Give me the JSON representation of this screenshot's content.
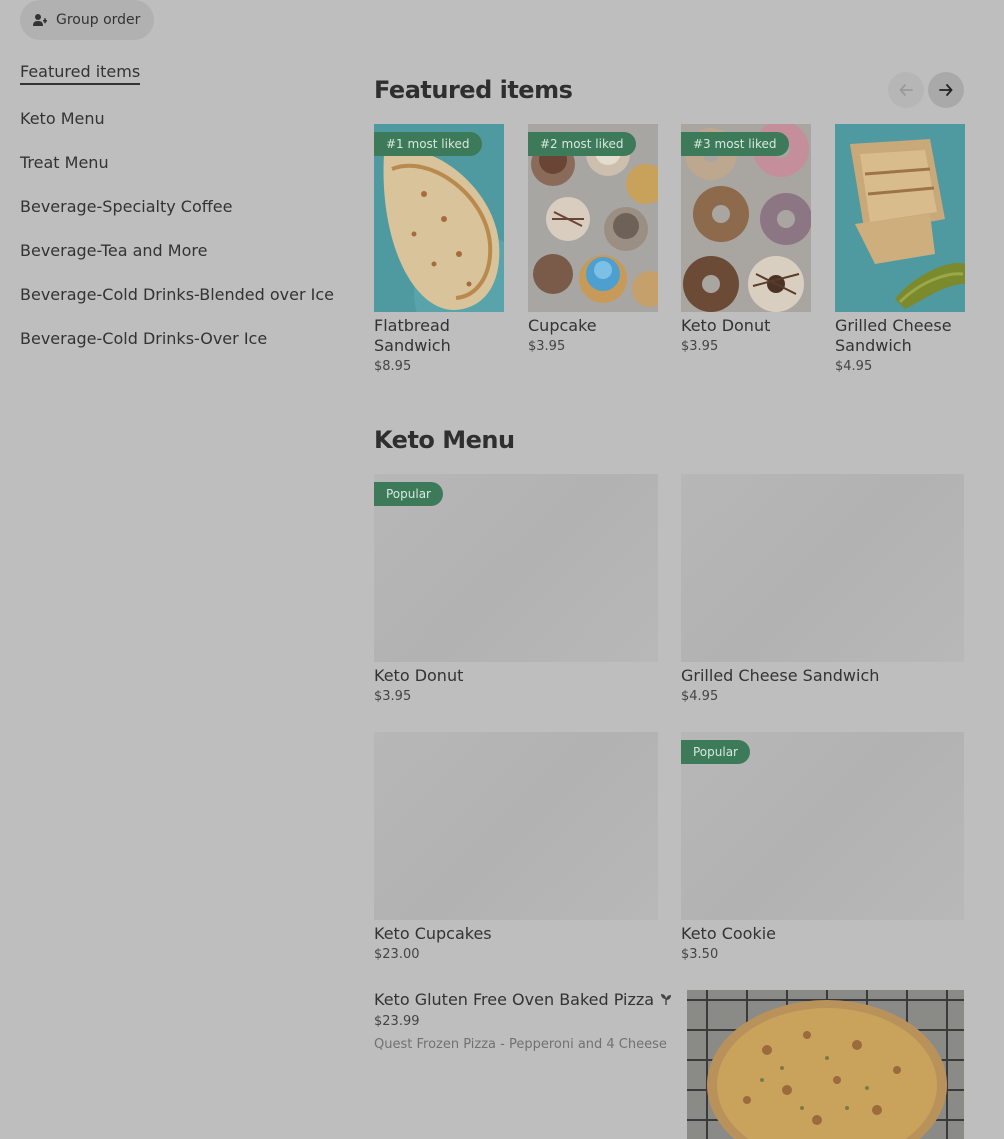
{
  "header": {
    "group_order_label": "Group order",
    "group_order_icon": "person-add-icon"
  },
  "sidebar": {
    "items": [
      {
        "label": "Featured items",
        "active": true
      },
      {
        "label": "Keto Menu"
      },
      {
        "label": "Treat Menu"
      },
      {
        "label": "Beverage-Specialty Coffee"
      },
      {
        "label": "Beverage-Tea and More"
      },
      {
        "label": "Beverage-Cold Drinks-Blended over Ice"
      },
      {
        "label": "Beverage-Cold Drinks-Over Ice"
      }
    ]
  },
  "featured": {
    "title": "Featured items",
    "prev_icon": "arrow-left-icon",
    "next_icon": "arrow-right-icon",
    "items": [
      {
        "badge": "#1 most liked",
        "name": "Flatbread Sandwich",
        "price": "$8.95"
      },
      {
        "badge": "#2 most liked",
        "name": "Cupcake",
        "price": "$3.95"
      },
      {
        "badge": "#3 most liked",
        "name": "Keto Donut",
        "price": "$3.95"
      },
      {
        "badge": "",
        "name": "Grilled Cheese Sandwich",
        "price": "$4.95"
      }
    ]
  },
  "keto_menu": {
    "title": "Keto Menu",
    "items": [
      {
        "badge": "Popular",
        "name": "Keto Donut",
        "price": "$3.95"
      },
      {
        "badge": "",
        "name": "Grilled Cheese Sandwich",
        "price": "$4.95"
      },
      {
        "badge": "",
        "name": "Keto Cupcakes",
        "price": "$23.00"
      },
      {
        "badge": "Popular",
        "name": "Keto Cookie",
        "price": "$3.50"
      }
    ],
    "pizza": {
      "name": "Keto Gluten Free Oven Baked Pizza",
      "name_icon": "plant-icon",
      "price": "$23.99",
      "description": "Quest Frozen Pizza - Pepperoni and 4 Cheese"
    }
  },
  "colors": {
    "badge_green": "#3d7a5a",
    "overlay_gray": "#bebebe"
  }
}
